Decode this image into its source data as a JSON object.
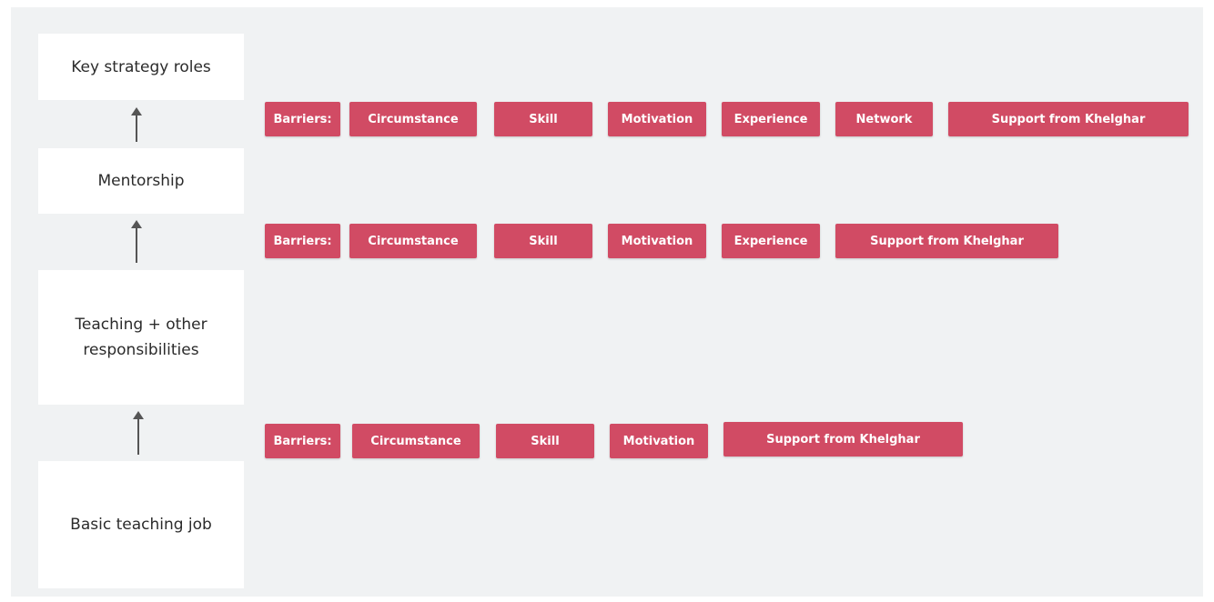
{
  "colors": {
    "background": "#f0f2f3",
    "stage_box": "#ffffff",
    "tag_fill": "#d14b64",
    "tag_text": "#ffffff",
    "arrow": "#555555"
  },
  "stages": [
    {
      "label": "Key strategy roles"
    },
    {
      "label": "Mentorship"
    },
    {
      "label": "Teaching + other responsibilities"
    },
    {
      "label": "Basic teaching job"
    }
  ],
  "barrier_rows": [
    {
      "between": [
        "Mentorship",
        "Key strategy roles"
      ],
      "label": "Barriers:",
      "items": [
        "Circumstance",
        "Skill",
        "Motivation",
        "Experience",
        "Network",
        "Support from Khelghar"
      ]
    },
    {
      "between": [
        "Teaching + other responsibilities",
        "Mentorship"
      ],
      "label": "Barriers:",
      "items": [
        "Circumstance",
        "Skill",
        "Motivation",
        "Experience",
        "Support from Khelghar"
      ]
    },
    {
      "between": [
        "Basic teaching job",
        "Teaching + other responsibilities"
      ],
      "label": "Barriers:",
      "items": [
        "Circumstance",
        "Skill",
        "Motivation",
        "Support from Khelghar"
      ]
    }
  ]
}
